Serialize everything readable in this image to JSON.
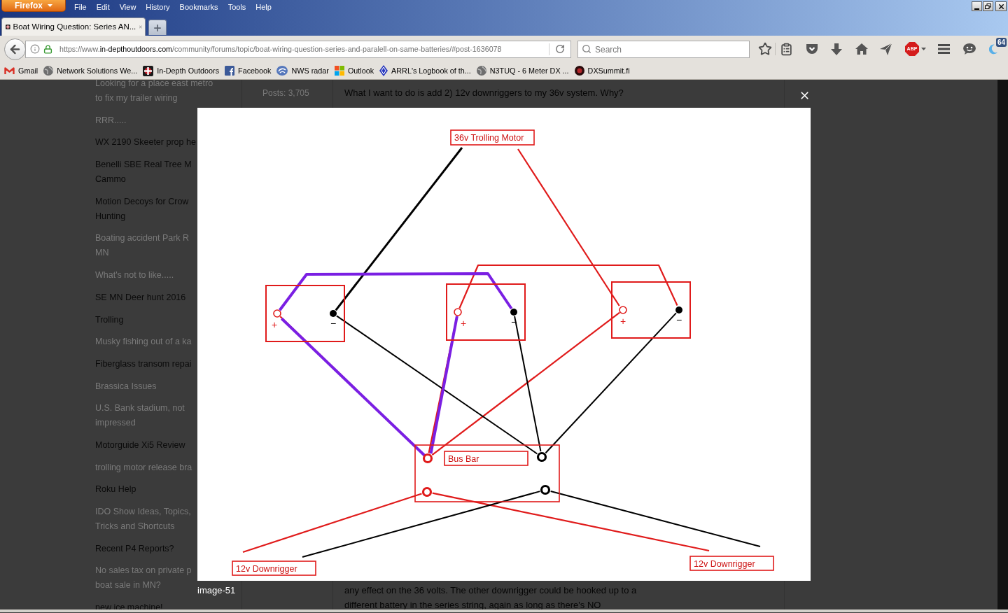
{
  "browser": {
    "app_button": "Firefox",
    "menu": [
      "File",
      "Edit",
      "View",
      "History",
      "Bookmarks",
      "Tools",
      "Help"
    ],
    "tabs": [
      {
        "title": "Boat Wiring Question: Series AN...",
        "selected": true
      }
    ],
    "address": {
      "scheme": "https://www.",
      "domain": "in-depthoutdoors.com",
      "path": "/community/forums/topic/boat-wiring-question-series-and-paralell-on-same-batteries/#post-1636078"
    },
    "search": {
      "placeholder": "Search"
    },
    "adblock_label": "ABP",
    "badge": "64",
    "bookmarks": [
      {
        "kind": "mail",
        "label": "Gmail"
      },
      {
        "kind": "globe",
        "label": "Network Solutions We..."
      },
      {
        "kind": "site",
        "label": "In-Depth Outdoors"
      },
      {
        "kind": "facebook",
        "label": "Facebook"
      },
      {
        "kind": "radar",
        "label": "NWS radar"
      },
      {
        "kind": "squares",
        "label": "Outlook"
      },
      {
        "kind": "diamond",
        "label": "ARRL's Logbook of th..."
      },
      {
        "kind": "globe",
        "label": "N3TUQ - 6 Meter DX ..."
      },
      {
        "kind": "disc",
        "label": "DXSummit.fi"
      }
    ]
  },
  "forum": {
    "topics": [
      {
        "lines": [
          "Looking for a place east metro",
          "to fix my trailer wiring"
        ],
        "read": true
      },
      {
        "lines": [
          "RRR....."
        ],
        "read": true
      },
      {
        "lines": [
          "WX 2190 Skeeter prop he"
        ],
        "read": false
      },
      {
        "lines": [
          "Benelli SBE Real Tree M",
          "Cammo"
        ],
        "read": false
      },
      {
        "lines": [
          "Motion Decoys for Crow",
          "Hunting"
        ],
        "read": false
      },
      {
        "lines": [
          "Boating accident Park R",
          "MN"
        ],
        "read": true
      },
      {
        "lines": [
          "What's not to like....."
        ],
        "read": true
      },
      {
        "lines": [
          "SE MN Deer hunt 2016"
        ],
        "read": false
      },
      {
        "lines": [
          "Trolling"
        ],
        "read": false
      },
      {
        "lines": [
          "Musky fishing out of a ka"
        ],
        "read": true
      },
      {
        "lines": [
          "Fiberglass transom repai"
        ],
        "read": false
      },
      {
        "lines": [
          "Brassica Issues"
        ],
        "read": true
      },
      {
        "lines": [
          "U.S. Bank stadium, not",
          "impressed"
        ],
        "read": true
      },
      {
        "lines": [
          "Motorguide Xi5 Review"
        ],
        "read": false
      },
      {
        "lines": [
          "trolling motor release bra"
        ],
        "read": true
      },
      {
        "lines": [
          "Roku Help"
        ],
        "read": false
      },
      {
        "lines": [
          "IDO Show Ideas, Topics,",
          "Tricks and Shortcuts"
        ],
        "read": true
      },
      {
        "lines": [
          "Recent P4 Reports?"
        ],
        "read": false
      },
      {
        "lines": [
          "No sales tax on private p",
          "boat sale in MN?"
        ],
        "read": true
      },
      {
        "lines": [
          "new ice machine!"
        ],
        "read": false
      }
    ],
    "author_posts": "Posts: 3,705",
    "post_first_line": "What I want to do is add 2) 12v downriggers to my 36v system. Why?",
    "post_last_lines": [
      "any effect on the 36 volts. The other downrigger could be hooked up to a",
      "different battery in the series string, again as long as there's NO"
    ]
  },
  "lightbox": {
    "caption": "image-51",
    "diagram": {
      "motor_label": "36v Trolling Motor",
      "batteries": [
        {
          "plus": "+",
          "minus": "−"
        },
        {
          "plus": "+",
          "minus": "−"
        },
        {
          "plus": "+",
          "minus": "−"
        }
      ],
      "bus_bar_label": "Bus Bar",
      "downriggers": [
        "12v Downrigger",
        "12v Downrigger"
      ]
    }
  }
}
